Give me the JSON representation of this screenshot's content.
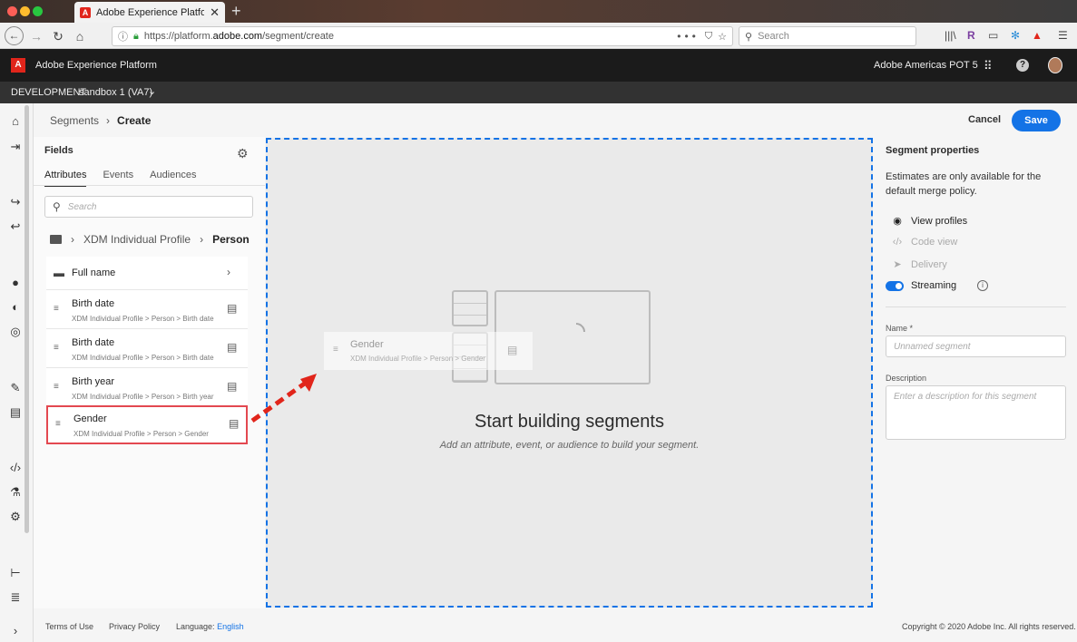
{
  "browser": {
    "tab_title": "Adobe Experience Platform - Se",
    "url_prefix": "https://platform.",
    "url_domain": "adobe.com",
    "url_path": "/segment/create",
    "search_placeholder": "Search"
  },
  "app": {
    "name": "Adobe Experience Platform",
    "org": "Adobe Americas POT 5",
    "env_label": "DEVELOPMENT",
    "sandbox": "sandbox 1 (VA7)"
  },
  "breadcrumb": {
    "parent": "Segments",
    "current": "Create"
  },
  "actions": {
    "cancel": "Cancel",
    "save": "Save"
  },
  "fields": {
    "title": "Fields",
    "tabs": [
      "Attributes",
      "Events",
      "Audiences"
    ],
    "search_placeholder": "Search",
    "path": {
      "root": "XDM Individual Profile",
      "current": "Person"
    },
    "folder": "Full name",
    "items": [
      {
        "title": "Birth date",
        "path": "XDM Individual Profile > Person > Birth date"
      },
      {
        "title": "Birth date",
        "path": "XDM Individual Profile > Person > Birth date"
      },
      {
        "title": "Birth year",
        "path": "XDM Individual Profile > Person > Birth year"
      },
      {
        "title": "Gender",
        "path": "XDM Individual Profile > Person > Gender"
      }
    ]
  },
  "canvas": {
    "heading": "Start building segments",
    "subheading": "Add an attribute, event, or audience to build your segment.",
    "drag_title": "Gender",
    "drag_path": "XDM Individual Profile > Person > Gender"
  },
  "properties": {
    "title": "Segment properties",
    "note": "Estimates are only available for the default merge policy.",
    "view_profiles": "View profiles",
    "code_view": "Code view",
    "delivery": "Delivery",
    "streaming": "Streaming",
    "name_label": "Name *",
    "name_placeholder": "Unnamed segment",
    "desc_label": "Description",
    "desc_placeholder": "Enter a description for this segment"
  },
  "footer": {
    "terms": "Terms of Use",
    "privacy": "Privacy Policy",
    "language_label": "Language:",
    "language": "English",
    "copyright": "Copyright  ©  2020 Adobe Inc.  All rights reserved."
  },
  "colors": {
    "accent": "#1473e6",
    "highlight": "#e34850",
    "brand": "#e1251b"
  }
}
